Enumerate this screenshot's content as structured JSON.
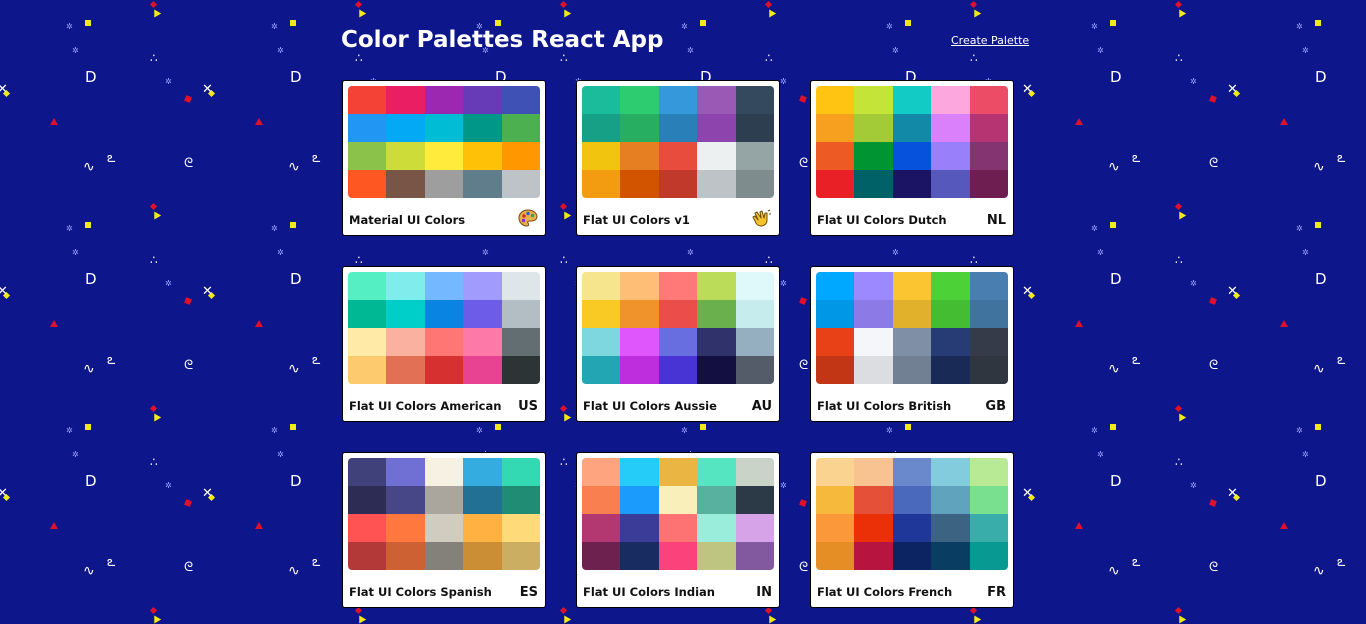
{
  "header": {
    "title": "Color Palettes React App",
    "create_link": "Create Palette"
  },
  "palettes": [
    {
      "name": "Material UI Colors",
      "emoji_label": "",
      "icon": "artist-palette-icon",
      "colors": [
        "#f44336",
        "#e91e63",
        "#9c27b0",
        "#673ab7",
        "#3f51b5",
        "#2196f3",
        "#03a9f4",
        "#00bcd4",
        "#009688",
        "#4caf50",
        "#8bc34a",
        "#cddc39",
        "#ffeb3b",
        "#ffc107",
        "#ff9800",
        "#ff5722",
        "#795548",
        "#9e9e9e",
        "#607d8b",
        "#bdc3c7"
      ]
    },
    {
      "name": "Flat UI Colors v1",
      "emoji_label": "",
      "icon": "waving-hand-icon",
      "colors": [
        "#1abc9c",
        "#2ecc71",
        "#3498db",
        "#9b59b6",
        "#34495e",
        "#16a085",
        "#27ae60",
        "#2980b9",
        "#8e44ad",
        "#2c3e50",
        "#f1c40f",
        "#e67e22",
        "#e74c3c",
        "#ecf0f1",
        "#95a5a6",
        "#f39c12",
        "#d35400",
        "#c0392b",
        "#bdc3c7",
        "#7f8c8d"
      ]
    },
    {
      "name": "Flat UI Colors Dutch",
      "emoji_label": "NL",
      "icon": "",
      "colors": [
        "#ffc312",
        "#c4e538",
        "#12cbc4",
        "#fda7df",
        "#ed4c67",
        "#f79f1f",
        "#a3cb38",
        "#1289a7",
        "#d980fa",
        "#b53471",
        "#ee5a24",
        "#009432",
        "#0652dd",
        "#9980fa",
        "#833471",
        "#ea2027",
        "#006266",
        "#1b1464",
        "#5758bb",
        "#6f1e51"
      ]
    },
    {
      "name": "Flat UI Colors American",
      "emoji_label": "US",
      "icon": "",
      "colors": [
        "#55efc4",
        "#81ecec",
        "#74b9ff",
        "#a29bfe",
        "#dfe6e9",
        "#00b894",
        "#00cec9",
        "#0984e3",
        "#6c5ce7",
        "#b2bec3",
        "#ffeaa7",
        "#fab1a0",
        "#ff7675",
        "#fd79a8",
        "#636e72",
        "#fdcb6e",
        "#e17055",
        "#d63031",
        "#e84393",
        "#2d3436"
      ]
    },
    {
      "name": "Flat UI Colors Aussie",
      "emoji_label": "AU",
      "icon": "",
      "colors": [
        "#f6e58d",
        "#ffbe76",
        "#ff7979",
        "#badc58",
        "#dff9fb",
        "#f9ca24",
        "#f0932b",
        "#eb4d4b",
        "#6ab04c",
        "#c7ecee",
        "#7ed6df",
        "#e056fd",
        "#686de0",
        "#30336b",
        "#95afc0",
        "#22a6b3",
        "#be2edd",
        "#4834d4",
        "#130f40",
        "#535c68"
      ]
    },
    {
      "name": "Flat UI Colors British",
      "emoji_label": "GB",
      "icon": "",
      "colors": [
        "#00a8ff",
        "#9c88ff",
        "#fbc531",
        "#4cd137",
        "#487eb0",
        "#0097e6",
        "#8c7ae6",
        "#e1b12c",
        "#44bd32",
        "#40739e",
        "#e84118",
        "#f5f6fa",
        "#7f8fa6",
        "#273c75",
        "#353b48",
        "#c23616",
        "#dcdde1",
        "#718093",
        "#192a56",
        "#2f3640"
      ]
    },
    {
      "name": "Flat UI Colors Spanish",
      "emoji_label": "ES",
      "icon": "",
      "colors": [
        "#40407a",
        "#706fd3",
        "#f7f1e3",
        "#34ace0",
        "#33d9b2",
        "#2c2c54",
        "#474787",
        "#aaa69d",
        "#227093",
        "#218c74",
        "#ff5252",
        "#ff793f",
        "#d1ccc0",
        "#ffb142",
        "#ffda79",
        "#b33939",
        "#cd6133",
        "#84817a",
        "#cc8e35",
        "#ccae62"
      ]
    },
    {
      "name": "Flat UI Colors Indian",
      "emoji_label": "IN",
      "icon": "",
      "colors": [
        "#fea47f",
        "#25ccf7",
        "#eab543",
        "#55e6c1",
        "#cad3c8",
        "#f97f51",
        "#1b9cfc",
        "#f8efba",
        "#58b19f",
        "#2c3a47",
        "#b33771",
        "#3b3b98",
        "#fd7272",
        "#9aecdb",
        "#d6a2e8",
        "#6d214f",
        "#182c61",
        "#fc427b",
        "#bdc581",
        "#82589f"
      ]
    },
    {
      "name": "Flat UI Colors French",
      "emoji_label": "FR",
      "icon": "",
      "colors": [
        "#fad390",
        "#f8c291",
        "#6a89cc",
        "#82ccdd",
        "#b8e994",
        "#f6b93b",
        "#e55039",
        "#4a69bd",
        "#60a3bc",
        "#78e08f",
        "#fa983a",
        "#eb2f06",
        "#1e3799",
        "#3c6382",
        "#38ada9",
        "#e58e26",
        "#b71540",
        "#0c2461",
        "#0a3d62",
        "#079992"
      ]
    }
  ]
}
